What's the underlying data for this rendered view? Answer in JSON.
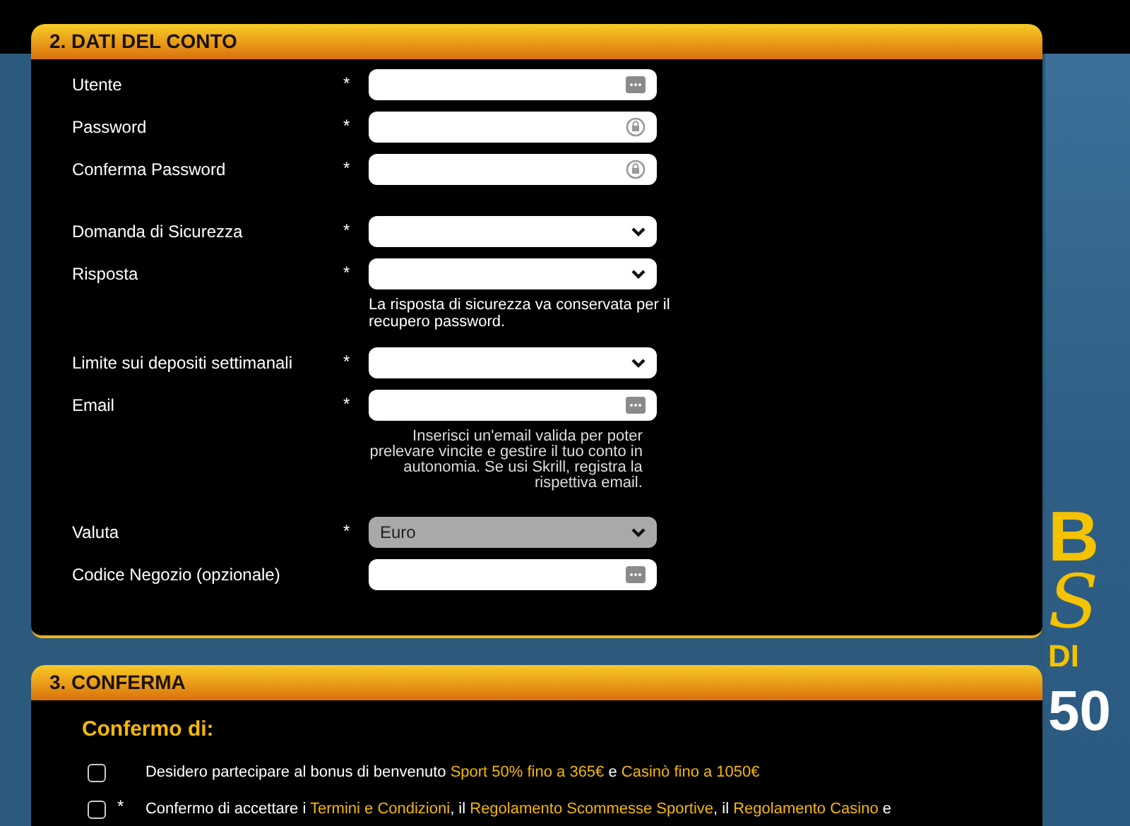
{
  "account_section": {
    "title": "2. DATI DEL CONTO",
    "field_groups": [
      [
        {
          "label": "Utente",
          "marker": "*",
          "kind": "text",
          "disabled": false
        },
        {
          "label": "Password",
          "marker": "*",
          "kind": "password",
          "disabled": false
        },
        {
          "label": "Conferma Password",
          "marker": "*",
          "kind": "password",
          "disabled": false
        }
      ],
      [
        {
          "label": "Domanda di Sicurezza",
          "marker": "*",
          "kind": "select",
          "disabled": false
        },
        {
          "label": "Risposta",
          "marker": "*",
          "kind": "select",
          "disabled": false,
          "note": {
            "kind": "info",
            "text": "La risposta di sicurezza va conservata per il recupero password."
          }
        },
        {
          "label": "Limite sui depositi settimanali",
          "marker": "*",
          "kind": "select",
          "disabled": false
        },
        {
          "label": "Email",
          "marker": "*",
          "kind": "text",
          "disabled": false,
          "note": {
            "kind": "hint",
            "text": "Inserisci un'email valida per poter prelevare vincite e gestire il tuo conto in autonomia. Se usi Skrill, registra la rispettiva email."
          }
        },
        {
          "label": "Valuta",
          "marker": "*",
          "kind": "select",
          "value": "Euro",
          "disabled": true
        },
        {
          "label": "Codice Negozio (opzionale)",
          "kind": "text",
          "disabled": false
        }
      ]
    ]
  },
  "confirm_section": {
    "title": "3. CONFERMA",
    "heading": "Confermo di:",
    "items": [
      {
        "checked": false,
        "parts": [
          {
            "text": "Desidero partecipare al bonus di benvenuto ",
            "link": false
          },
          {
            "text": "Sport 50% fino a 365€",
            "link": true
          },
          {
            "text": " e ",
            "link": false
          },
          {
            "text": "Casinò fino a 1050€",
            "link": true
          }
        ]
      },
      {
        "checked": false,
        "marker": "*",
        "parts": [
          {
            "text": "Confermo di accettare i ",
            "link": false
          },
          {
            "text": "Termini e Condizioni",
            "link": true
          },
          {
            "text": ", il ",
            "link": false
          },
          {
            "text": "Regolamento Scommesse Sportive",
            "link": true
          },
          {
            "text": ", il ",
            "link": false
          },
          {
            "text": "Regolamento Casino",
            "link": true
          },
          {
            "text": " e",
            "link": false
          }
        ]
      }
    ]
  },
  "banner": {
    "lines": [
      {
        "text": "B",
        "kind": "big"
      },
      {
        "text": "S",
        "kind": "script"
      },
      {
        "text": "DI",
        "kind": "small"
      },
      {
        "text": "50",
        "kind": "number"
      }
    ]
  }
}
